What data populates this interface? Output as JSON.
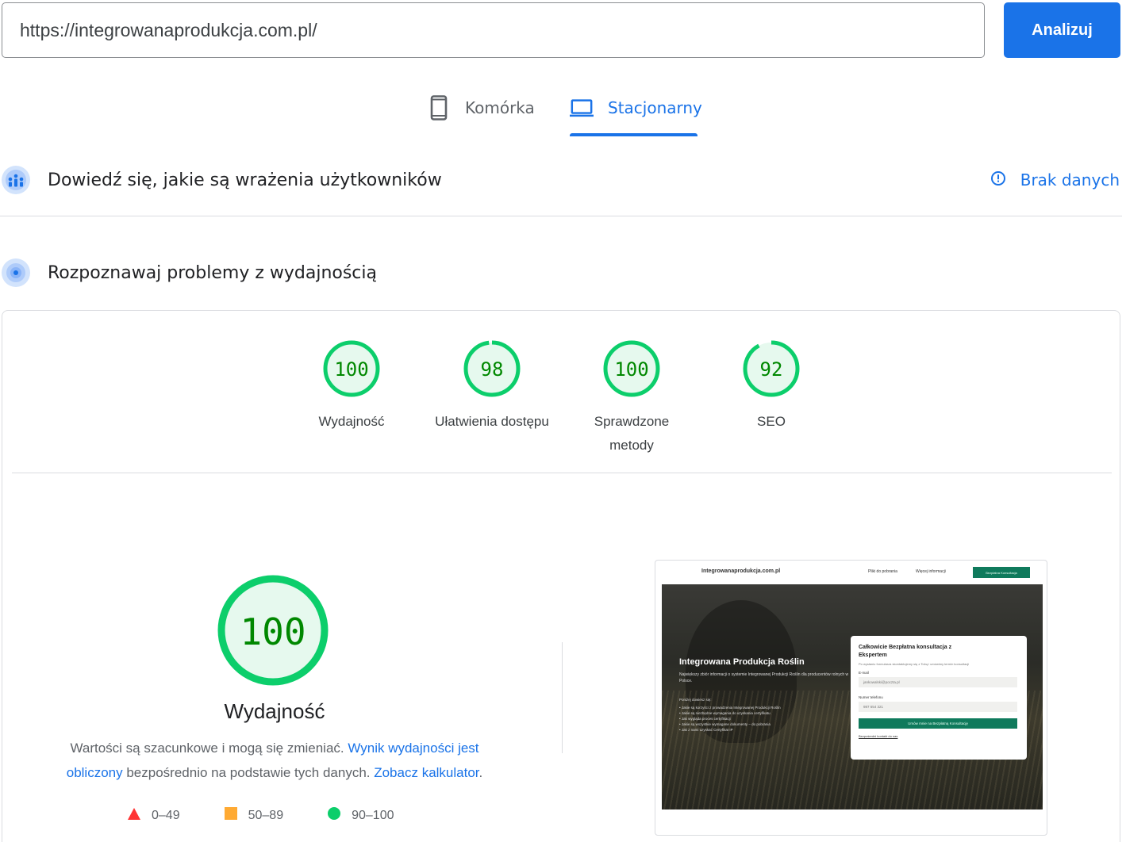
{
  "url_bar": {
    "value": "https://integrowanaprodukcja.com.pl/",
    "analyze_label": "Analizuj"
  },
  "tabs": [
    {
      "label": "Komórka",
      "icon": "smartphone-icon",
      "active": false
    },
    {
      "label": "Stacjonarny",
      "icon": "laptop-icon",
      "active": true
    }
  ],
  "crux": {
    "title": "Dowiedź się, jakie są wrażenia użytkowników",
    "no_data_label": "Brak danych"
  },
  "lighthouse": {
    "title": "Rozpoznawaj problemy z wydajnością"
  },
  "scores": [
    {
      "value": "100",
      "label": "Wydajność",
      "score": 100
    },
    {
      "value": "98",
      "label": "Ułatwienia dostępu",
      "score": 98
    },
    {
      "value": "100",
      "label": "Sprawdzone metody",
      "score": 100
    },
    {
      "value": "92",
      "label": "SEO",
      "score": 92
    }
  ],
  "performance": {
    "score": "100",
    "title": "Wydajność",
    "desc_part1": "Wartości są szacunkowe i mogą się zmieniać. ",
    "desc_link1": "Wynik wydajności jest obliczony",
    "desc_part2": " bezpośrednio na podstawie tych danych. ",
    "desc_link2": "Zobacz kalkulator",
    "desc_part3": "."
  },
  "legend": [
    {
      "range": "0–49",
      "shape": "triangle",
      "color": "#ff3333"
    },
    {
      "range": "50–89",
      "shape": "square",
      "color": "#ffaa33"
    },
    {
      "range": "90–100",
      "shape": "circle",
      "color": "#0cce6b"
    }
  ],
  "colors": {
    "accent": "#1a73e8",
    "pass": "#0cce6b",
    "pass_text": "#008800",
    "pass_fill": "#e6f9ee"
  },
  "thumbnail": {
    "brand": "Integrowanaprodukcja.com.pl",
    "nav_link1": "Pliki do pobrania",
    "nav_link2": "Więcej informacji",
    "nav_button": "Bezpłatna Konsultacja",
    "hero_title": "Integrowana Produkcja Roślin",
    "hero_sub": "Największy zbiór informacji o systemie Integrowanej Produkcji Roślin dla producentów rolnych w Polsce.",
    "hero_list_intro": "Poniżej dowiesz się:",
    "hero_list": [
      "Jakie są korzyści z prowadzenia Integrowanej Produkcji Roślin",
      "Jakie są niezbędne wymagania do uzyskania certyfikatu",
      "Jak wygląda proces certyfikacji",
      "Jakie są wszystkie wymagane dokumenty – do pobrania",
      "Jak z nami uzyskać Certyfikat IP"
    ],
    "form_title": "Całkowicie Bezpłatna konsultacja z Ekspertem",
    "form_subtitle": "Po wysłaniu formularza skontaktujemy się z Tobą i umówimy termin konsultacji",
    "email_label": "E-mail",
    "email_placeholder": "jankowalski@poczta.pl",
    "phone_label": "Numer telefonu",
    "phone_placeholder": "987 654 321",
    "form_button": "Umów mnie na Bezpłatną Konsultację",
    "form_footer": "Bezpośredni kontakt do nas"
  }
}
